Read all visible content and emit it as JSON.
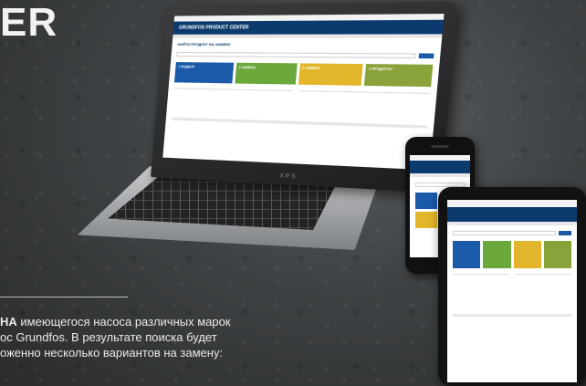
{
  "headline": "ER",
  "caption": {
    "bold": "НА",
    "line1_rest": " имеющегося насоса различных марок",
    "line2": "ос Grundfos. В результате поиска будет",
    "line3": "оженно несколько вариантов на замену:"
  },
  "laptop": {
    "logo_text": "XPS"
  },
  "site": {
    "brand": "GRUNDFOS PRODUCT CENTER",
    "title": "НАЙТИ ПРОДУКТ НА ЗАМЕНУ",
    "steps": [
      {
        "label": "1 ПОДБОР"
      },
      {
        "label": "2 ЗАМЕНА"
      },
      {
        "label": "3 ЗАМЕНА"
      },
      {
        "label": "4 ПРОДУКТЫ"
      }
    ]
  },
  "colors": {
    "header_blue": "#0b3b6e",
    "step_blue": "#1a5aa8",
    "step_green": "#6aa83b",
    "step_yellow": "#e3b52a",
    "step_olive": "#8aa23a"
  }
}
